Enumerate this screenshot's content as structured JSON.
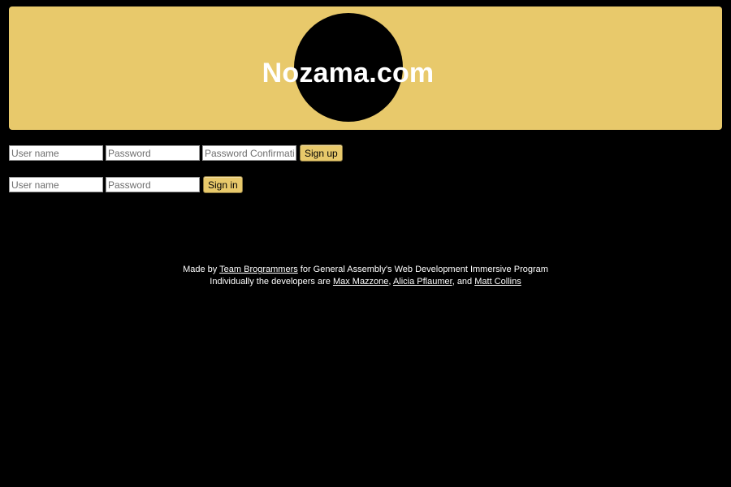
{
  "header": {
    "title": "Nozama.com"
  },
  "signup_form": {
    "username_placeholder": "User name",
    "password_placeholder": "Password",
    "password_confirmation_placeholder": "Password Confirmation",
    "submit_label": "Sign up"
  },
  "signin_form": {
    "username_placeholder": "User name",
    "password_placeholder": "Password",
    "submit_label": "Sign in"
  },
  "footer": {
    "line1_prefix": "Made by ",
    "team_link": "Team Brogrammers",
    "line1_suffix": " for General Assembly's Web Development Immersive Program",
    "line2_prefix": "Individually the developers are ",
    "developer1": "Max Mazzone",
    "sep1": ", ",
    "developer2": "Alicia Pflaumer",
    "sep2": ", and ",
    "developer3": "Matt Collins"
  },
  "colors": {
    "background": "#000000",
    "accent": "#e8c96b",
    "text": "#ffffff"
  }
}
